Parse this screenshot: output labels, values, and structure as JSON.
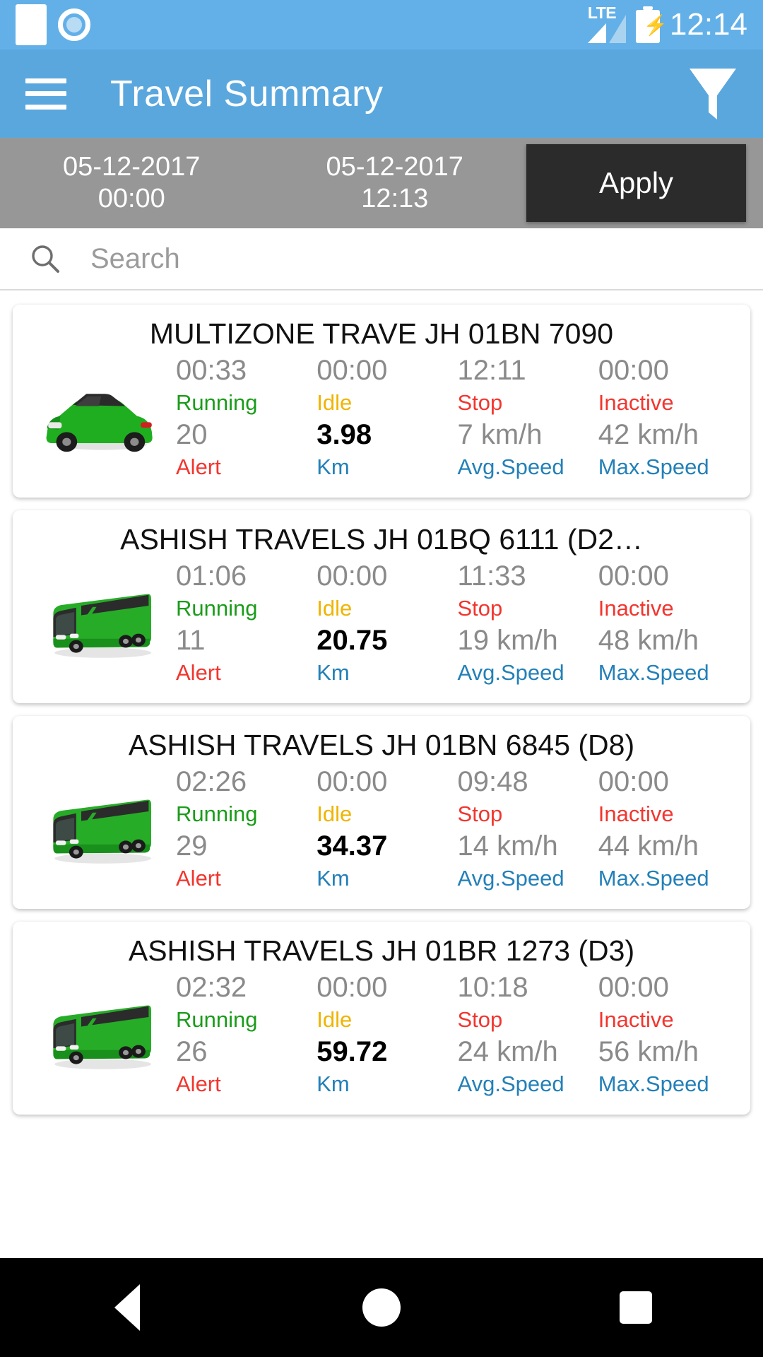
{
  "status_bar": {
    "network": "LTE",
    "time": "12:14",
    "icons": [
      "white-square-icon",
      "record-circle-icon",
      "lte-signal-icon",
      "battery-charging-icon"
    ]
  },
  "app_bar": {
    "menu_icon": "hamburger-menu-icon",
    "title": "Travel Summary",
    "filter_icon": "filter-funnel-icon"
  },
  "date_filter": {
    "from_date": "05-12-2017",
    "from_time": "00:00",
    "to_date": "05-12-2017",
    "to_time": "12:13",
    "apply_label": "Apply"
  },
  "search": {
    "icon": "search-icon",
    "placeholder": "Search",
    "value": ""
  },
  "stat_labels": {
    "running": "Running",
    "idle": "Idle",
    "stop": "Stop",
    "inactive": "Inactive",
    "alert": "Alert",
    "km": "Km",
    "avg_speed": "Avg.Speed",
    "max_speed": "Max.Speed"
  },
  "colors": {
    "app_bar": "#5aa7de",
    "status_bar": "#63b0e8",
    "date_bar": "#979797",
    "apply_button": "#2b2b2b",
    "running": "#1a9c1a",
    "idle": "#f0b400",
    "stop": "#f2352e",
    "inactive": "#f2352e",
    "alert": "#f2352e",
    "link_blue": "#2380b8",
    "value_gray": "#8a8a8a",
    "km_value": "#000000"
  },
  "vehicles": [
    {
      "title": "MULTIZONE TRAVE   JH 01BN 7090",
      "icon": "green-car-icon",
      "running": "00:33",
      "idle": "00:00",
      "stop": "12:11",
      "inactive": "00:00",
      "alert": "20",
      "km": "3.98",
      "avg_speed": "7 km/h",
      "max_speed": "42 km/h"
    },
    {
      "title": "ASHISH TRAVELS   JH 01BQ 6111 (D2…",
      "icon": "green-bus-icon",
      "running": "01:06",
      "idle": "00:00",
      "stop": "11:33",
      "inactive": "00:00",
      "alert": "11",
      "km": "20.75",
      "avg_speed": "19 km/h",
      "max_speed": "48 km/h"
    },
    {
      "title": "ASHISH TRAVELS   JH 01BN 6845 (D8)",
      "icon": "green-bus-icon",
      "running": "02:26",
      "idle": "00:00",
      "stop": "09:48",
      "inactive": "00:00",
      "alert": "29",
      "km": "34.37",
      "avg_speed": "14 km/h",
      "max_speed": "44 km/h"
    },
    {
      "title": "ASHISH TRAVELS   JH 01BR 1273 (D3)",
      "icon": "green-bus-icon",
      "running": "02:32",
      "idle": "00:00",
      "stop": "10:18",
      "inactive": "00:00",
      "alert": "26",
      "km": "59.72",
      "avg_speed": "24 km/h",
      "max_speed": "56 km/h"
    }
  ],
  "nav_bar": {
    "back": "back-triangle-icon",
    "home": "home-circle-icon",
    "recents": "recents-square-icon"
  }
}
